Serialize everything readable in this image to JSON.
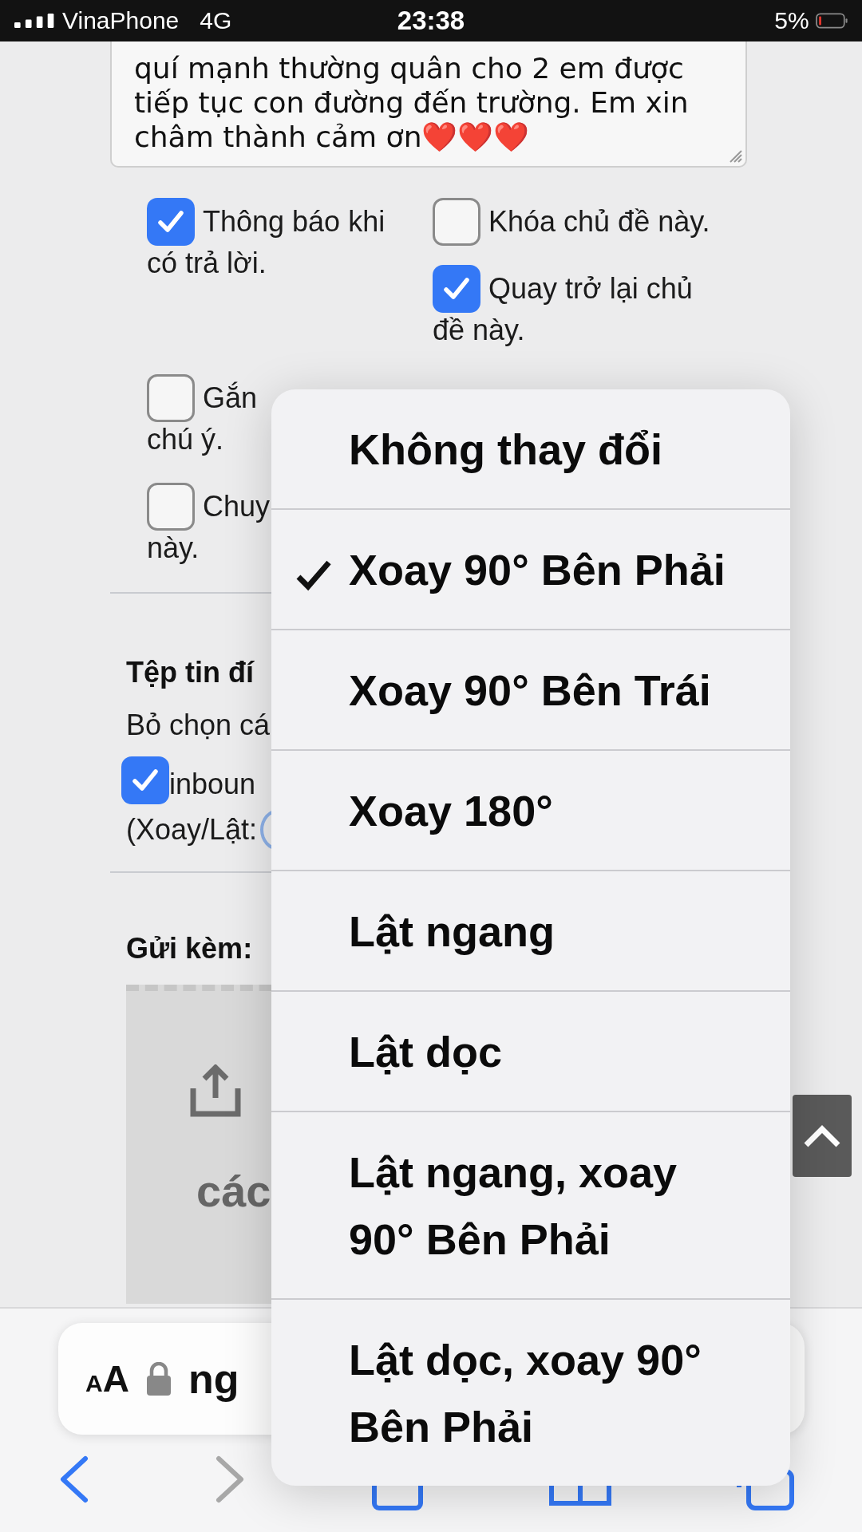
{
  "status_bar": {
    "carrier": "VinaPhone",
    "network": "4G",
    "time": "23:38",
    "battery": "5%"
  },
  "message": {
    "lines": [
      "quí mạnh thường quân cho 2 em được",
      "tiếp tục con đường đến trường. Em xin",
      "châm thành cảm ơn"
    ],
    "emoji": "❤️❤️❤️"
  },
  "options": {
    "columns": [
      [
        {
          "lines": [
            "Thông báo khi",
            "có trả lời."
          ],
          "checked": true
        },
        {
          "lines": [
            "Gắn",
            "chú ý."
          ],
          "checked": false
        },
        {
          "lines": [
            "Chuy",
            "này."
          ],
          "checked": false
        }
      ],
      [
        {
          "lines": [
            "Khóa chủ đề này."
          ],
          "checked": false
        },
        {
          "lines": [
            "Quay trở lại chủ",
            "đề này."
          ],
          "checked": true
        }
      ]
    ]
  },
  "files": {
    "title": "Tệp tin đí",
    "hint": "Bỏ chọn cá",
    "items": [
      {
        "name": "inboun",
        "checked": true,
        "rotate_label": "(Xoay/Lật:"
      }
    ]
  },
  "attach": {
    "title": "Gửi kèm:",
    "drop_text": "các"
  },
  "menu": {
    "items": [
      {
        "label": "Không thay đổi",
        "selected": false
      },
      {
        "label": "Xoay 90° Bên Phải",
        "selected": true
      },
      {
        "label": "Xoay 90° Bên Trái",
        "selected": false
      },
      {
        "label": "Xoay 180°",
        "selected": false
      },
      {
        "label": "Lật ngang",
        "selected": false
      },
      {
        "label": "Lật dọc",
        "selected": false
      },
      {
        "label": "Lật ngang, xoay 90° Bên Phải",
        "selected": false
      },
      {
        "label": "Lật dọc, xoay 90° Bên Phải",
        "selected": false
      }
    ]
  },
  "browser": {
    "reader": [
      "A",
      "A"
    ],
    "address": "ng"
  }
}
